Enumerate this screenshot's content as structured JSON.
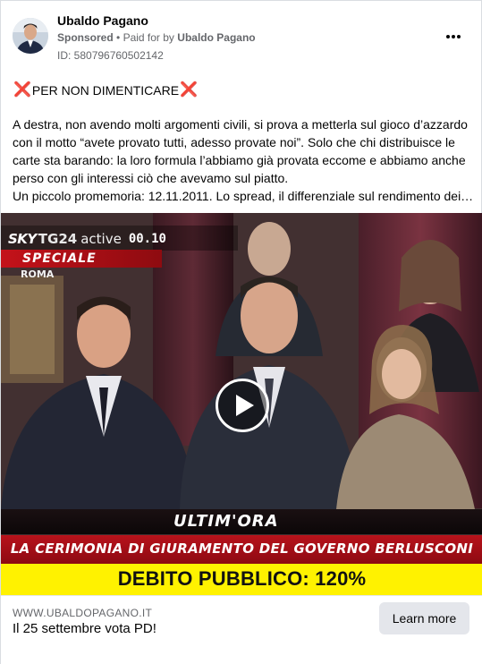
{
  "post": {
    "page_name": "Ubaldo Pagano",
    "sponsored": "Sponsored",
    "separator": "•",
    "paid_for_prefix": "Paid for by",
    "paid_for_name": "Ubaldo Pagano",
    "ad_id": "ID: 580796760502142",
    "more_icon": "more-horizontal-icon",
    "headline": "PER NON DIMENTICARE",
    "headline_marker": "❌",
    "body": [
      "A destra, non avendo molti argomenti civili, si prova a metterla sul gioco d’azzardo con il motto “avete provato tutti, adesso provate noi”. Solo che chi distribuisce le carte sta barando: la loro formula l’abbiamo già provata eccome e abbiamo anche perso con gli interessi ciò che avevamo sul piatto.",
      "Un piccolo promemoria: 12.11.2011. Lo spread, il differenziale sul rendimento dei…"
    ]
  },
  "video": {
    "play_icon": "play-icon",
    "channel_sky": "SKY",
    "channel_tg": "TG24",
    "channel_active": "active",
    "time": "00.10",
    "speciale": "SPECIALE",
    "location": "ROMA",
    "ultimora": "ULTIM'ORA",
    "caption": "LA CERIMONIA DI GIURAMENTO DEL GOVERNO BERLUSCONI",
    "debt_caption": "DEBITO PUBBLICO: 120%"
  },
  "footer": {
    "domain": "WWW.UBALDOPAGANO.IT",
    "headline": "Il 25 settembre vota PD!",
    "cta": "Learn more"
  },
  "colors": {
    "accent_red": "#c4121a",
    "banner_yellow": "#fff200",
    "button_gray": "#e4e6eb",
    "meta_gray": "#65676b"
  }
}
